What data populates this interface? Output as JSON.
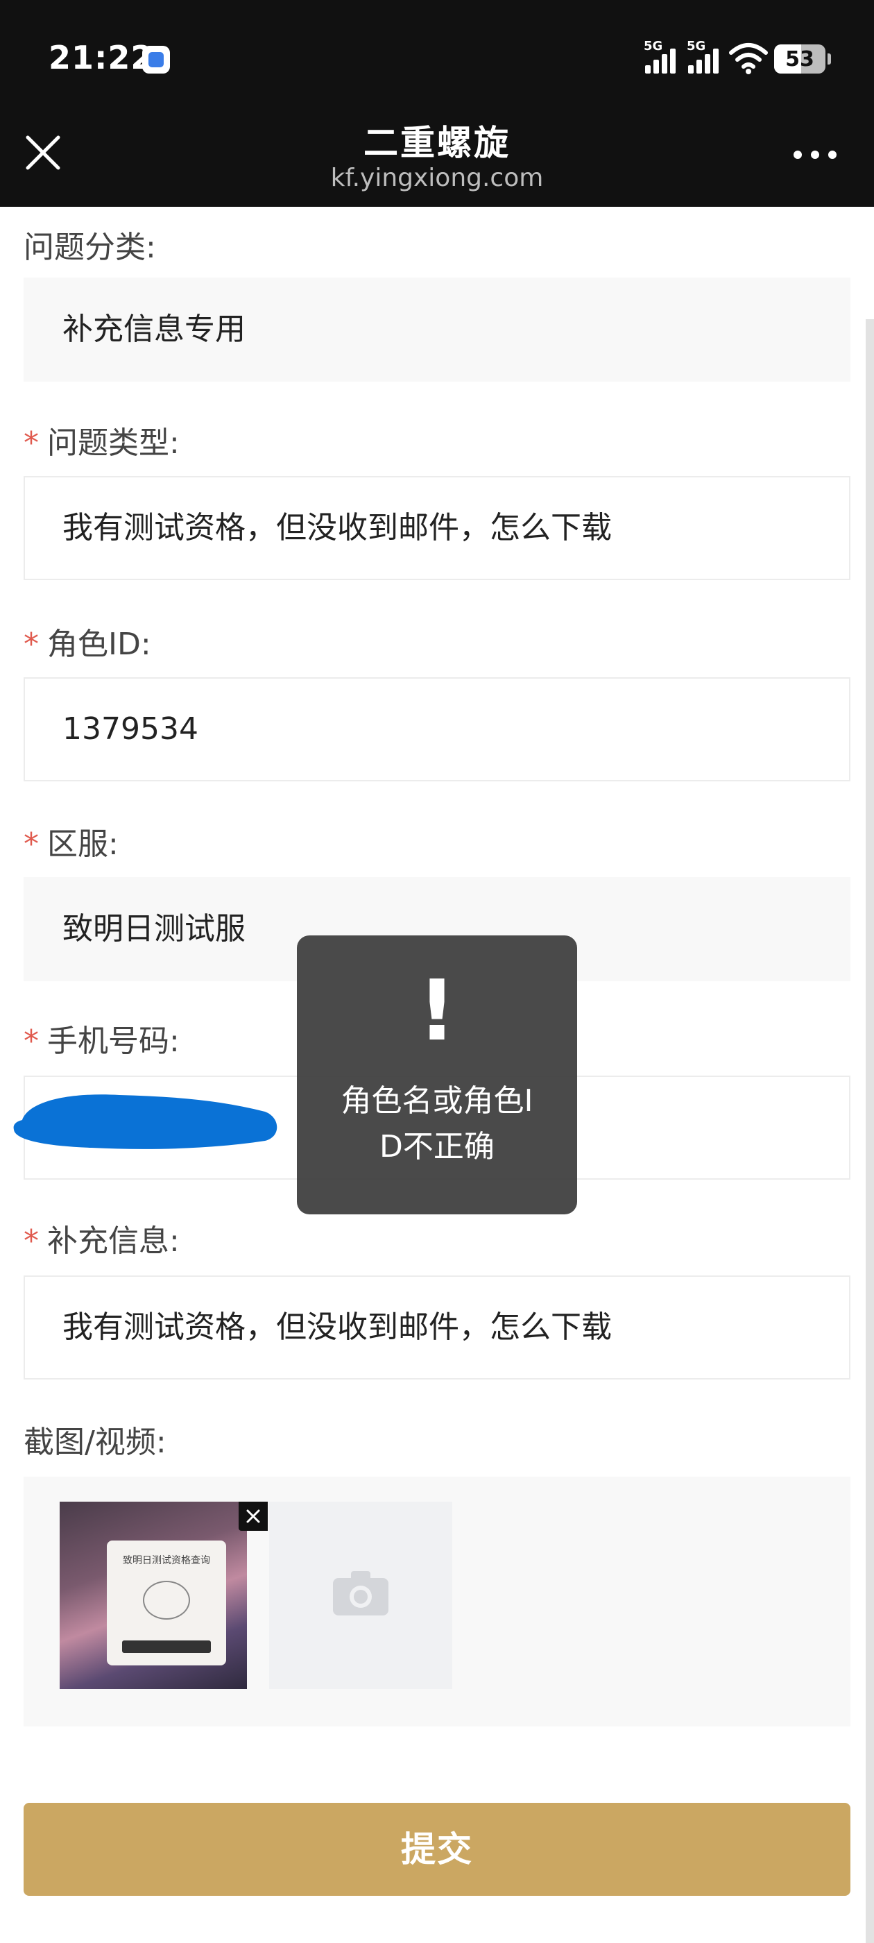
{
  "status_bar": {
    "time": "21:22",
    "signal_1": "5G",
    "signal_2": "5G",
    "battery": "53",
    "battery_level": 0.53
  },
  "nav": {
    "title": "二重螺旋",
    "url": "kf.yingxiong.com"
  },
  "form": {
    "category": {
      "label": "问题分类:",
      "value": "补充信息专用"
    },
    "issue_type": {
      "required": "*",
      "label": "问题类型:",
      "value": "我有测试资格，但没收到邮件，怎么下载"
    },
    "role_id": {
      "required": "*",
      "label": "角色ID:",
      "value": "1379534"
    },
    "server": {
      "required": "*",
      "label": "区服:",
      "value": "致明日测试服"
    },
    "phone": {
      "required": "*",
      "label": "手机号码:",
      "value": ""
    },
    "extra_info": {
      "required": "*",
      "label": "补充信息:",
      "value": "我有测试资格，但没收到邮件，怎么下载"
    },
    "attachments": {
      "label": "截图/视频:",
      "thumbnail_title": "致明日测试资格查询"
    },
    "submit_label": "提交"
  },
  "toast": {
    "icon": "!",
    "message": "角色名或角色ID不正确"
  },
  "colors": {
    "accent": "#cba762",
    "required": "#e05a4e",
    "header": "#111111",
    "toast_bg": "#3c3c3c",
    "redaction": "#0a72d6"
  }
}
